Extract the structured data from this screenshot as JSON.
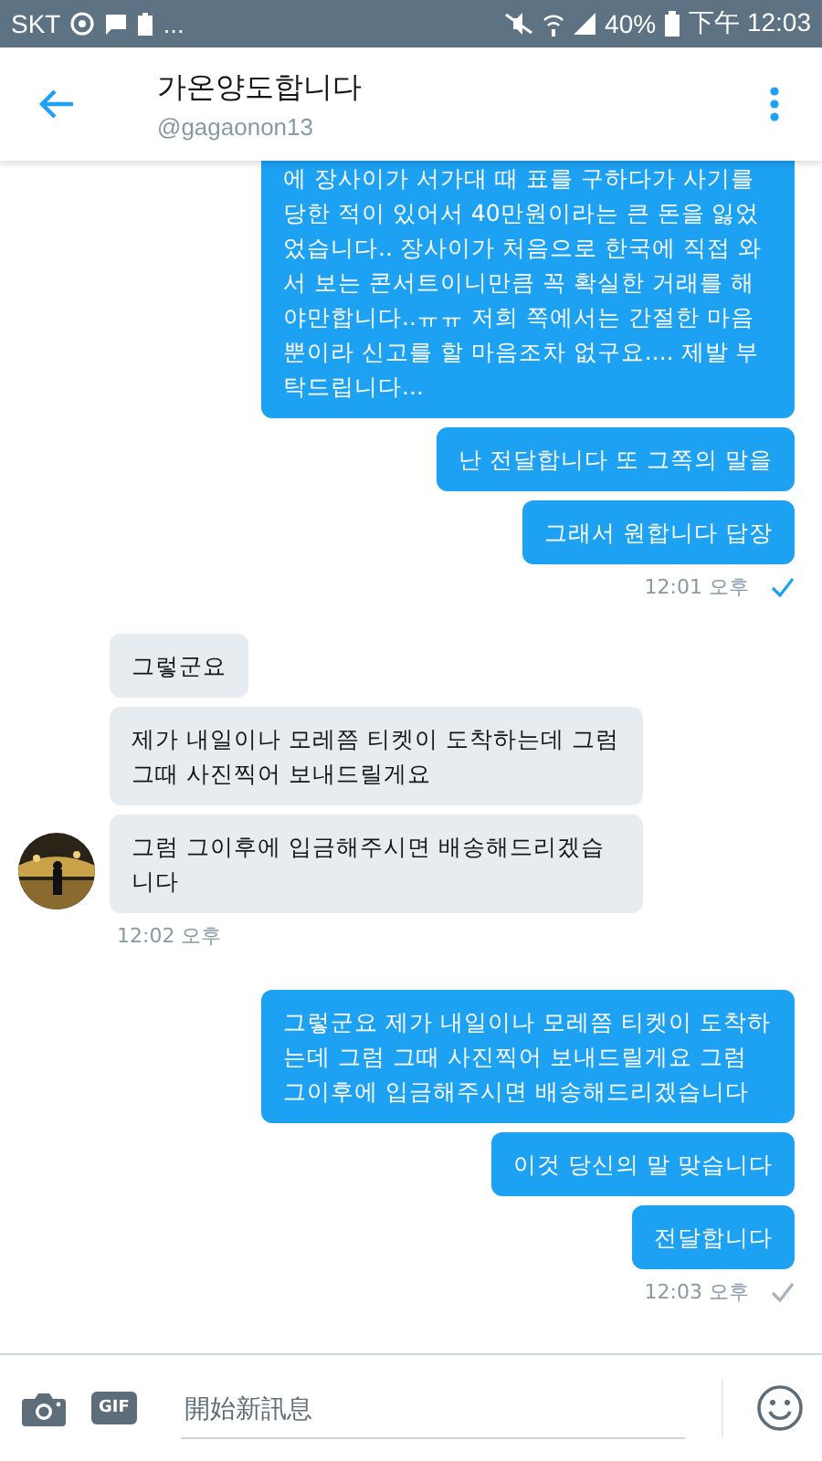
{
  "status_bar": {
    "carrier": "SKT",
    "more": "...",
    "battery": "40%",
    "time": "下午 12:03"
  },
  "header": {
    "title": "가온양도합니다",
    "handle": "@gagaonon13"
  },
  "groups": [
    {
      "kind": "sent",
      "cut_top": true,
      "messages": [
        "에 장사이가 서가대 때 표를 구하다가 사기를 당한 적이 있어서 40만원이라는 큰 돈을 잃었었습니다.. 장사이가 처음으로 한국에 직접 와서 보는 콘서트이니만큼 꼭 확실한 거래를 해야만합니다..ㅠㅠ 저희 쪽에서는 간절한 마음뿐이라 신고를 할 마음조차 없구요.... 제발 부탁드립니다...",
        "난 전달합니다 또 그쪽의 말을",
        "그래서 원합니다 답장"
      ],
      "time": "12:01 오후",
      "read": true
    },
    {
      "kind": "received",
      "cut_top": false,
      "messages": [
        "그렇군요",
        "제가 내일이나 모레쯤 티켓이 도착하는데 그럼 그때 사진찍어 보내드릴게요",
        "그럼 그이후에 입금해주시면 배송해드리겠습니다"
      ],
      "time": "12:02 오후"
    },
    {
      "kind": "sent",
      "cut_top": false,
      "messages": [
        "그렇군요 제가 내일이나 모레쯤 티켓이 도착하는데 그럼 그때 사진찍어 보내드릴게요 그럼 그이후에 입금해주시면 배송해드리겠습니다",
        "이것 당신의 말 맞습니다",
        "전달합니다"
      ],
      "time": "12:03 오후",
      "read": false
    }
  ],
  "composer": {
    "gif_label": "GIF",
    "placeholder": "開始新訊息"
  }
}
